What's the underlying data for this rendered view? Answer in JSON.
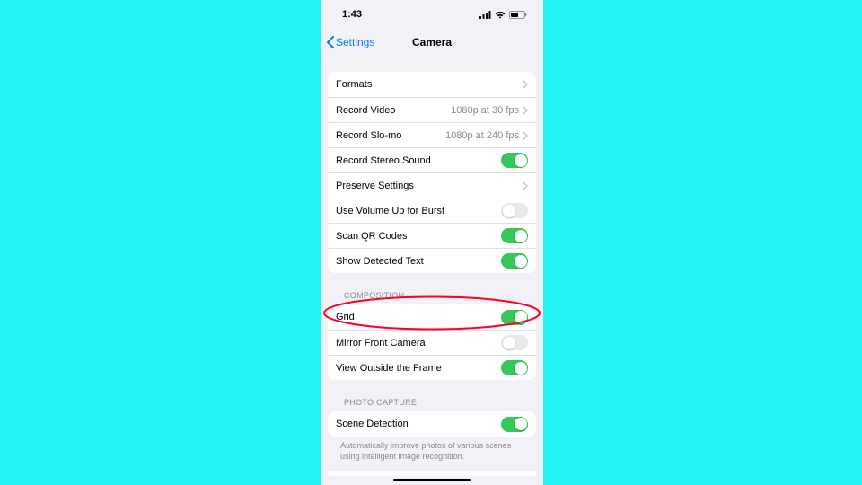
{
  "statusbar": {
    "time": "1:43"
  },
  "nav": {
    "back_label": "Settings",
    "title": "Camera"
  },
  "group1": {
    "formats": {
      "label": "Formats"
    },
    "record_video": {
      "label": "Record Video",
      "detail": "1080p at 30 fps"
    },
    "record_slomo": {
      "label": "Record Slo-mo",
      "detail": "1080p at 240 fps"
    },
    "stereo": {
      "label": "Record Stereo Sound"
    },
    "preserve": {
      "label": "Preserve Settings"
    },
    "volume_burst": {
      "label": "Use Volume Up for Burst"
    },
    "scan_qr": {
      "label": "Scan QR Codes"
    },
    "detected_text": {
      "label": "Show Detected Text"
    }
  },
  "composition": {
    "header": "COMPOSITION",
    "grid": {
      "label": "Grid"
    },
    "mirror": {
      "label": "Mirror Front Camera"
    },
    "outside": {
      "label": "View Outside the Frame"
    }
  },
  "photo_capture": {
    "header": "PHOTO CAPTURE",
    "scene": {
      "label": "Scene Detection"
    },
    "footer": "Automatically improve photos of various scenes using intelligent image recognition."
  },
  "colors": {
    "accent_blue": "#007aff",
    "toggle_green": "#34c759",
    "highlight": "#ff0022"
  }
}
